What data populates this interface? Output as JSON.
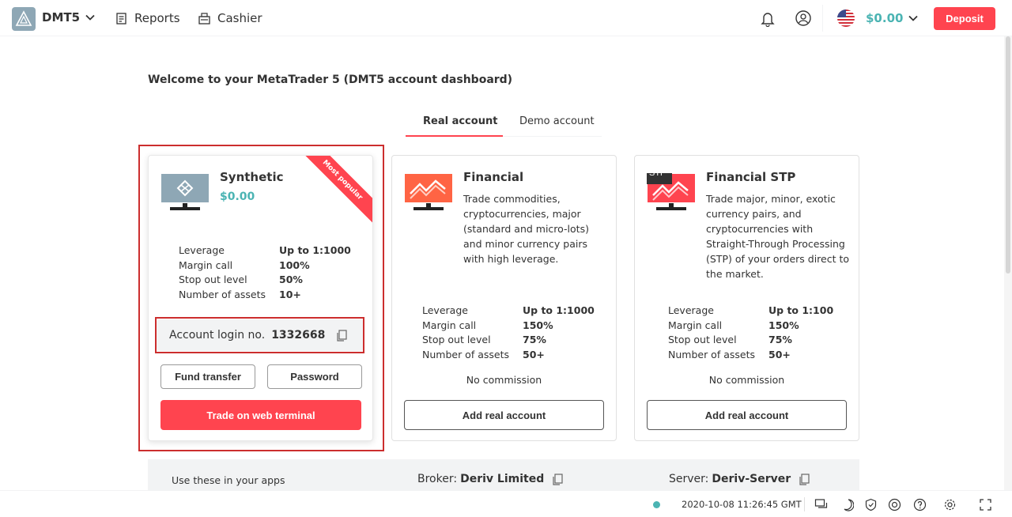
{
  "header": {
    "platform": "DMT5",
    "menu": [
      {
        "label": "Reports",
        "icon": "reports-icon"
      },
      {
        "label": "Cashier",
        "icon": "cashier-icon"
      }
    ],
    "balance": "$0.00",
    "deposit_label": "Deposit"
  },
  "page": {
    "title": "Welcome to your MetaTrader 5 (DMT5 account dashboard)"
  },
  "tabs": [
    {
      "label": "Real account",
      "active": true
    },
    {
      "label": "Demo account",
      "active": false
    }
  ],
  "cards": {
    "synthetic": {
      "title": "Synthetic",
      "balance": "$0.00",
      "ribbon": "Most popular",
      "specs": [
        {
          "label": "Leverage",
          "value": "Up to 1:1000"
        },
        {
          "label": "Margin call",
          "value": "100%"
        },
        {
          "label": "Stop out level",
          "value": "50%"
        },
        {
          "label": "Number of assets",
          "value": "10+"
        }
      ],
      "login_label": "Account login no.",
      "login_number": "1332668",
      "fund_transfer_label": "Fund transfer",
      "password_label": "Password",
      "trade_label": "Trade on web terminal"
    },
    "financial": {
      "title": "Financial",
      "description": "Trade commodities, cryptocurrencies, major (standard and micro-lots) and minor currency pairs with high leverage.",
      "specs": [
        {
          "label": "Leverage",
          "value": "Up to 1:1000"
        },
        {
          "label": "Margin call",
          "value": "150%"
        },
        {
          "label": "Stop out level",
          "value": "75%"
        },
        {
          "label": "Number of assets",
          "value": "50+"
        }
      ],
      "commission": "No commission",
      "add_label": "Add real account"
    },
    "stp": {
      "title": "Financial STP",
      "badge": "STP",
      "description": "Trade major, minor, exotic currency pairs, and cryptocurrencies with Straight-Through Processing (STP) of your orders direct to the market.",
      "specs": [
        {
          "label": "Leverage",
          "value": "Up to 1:100"
        },
        {
          "label": "Margin call",
          "value": "150%"
        },
        {
          "label": "Stop out level",
          "value": "75%"
        },
        {
          "label": "Number of assets",
          "value": "50+"
        }
      ],
      "commission": "No commission",
      "add_label": "Add real account"
    }
  },
  "info": {
    "hint": "Use these in your apps",
    "broker_label": "Broker:",
    "broker_value": "Deriv Limited",
    "server_label": "Server:",
    "server_value": "Deriv-Server"
  },
  "footer": {
    "time": "2020-10-08 11:26:45 GMT"
  },
  "colors": {
    "accent": "#ff444f",
    "teal": "#4bb4b3",
    "highlight": "#cc2e2e"
  }
}
